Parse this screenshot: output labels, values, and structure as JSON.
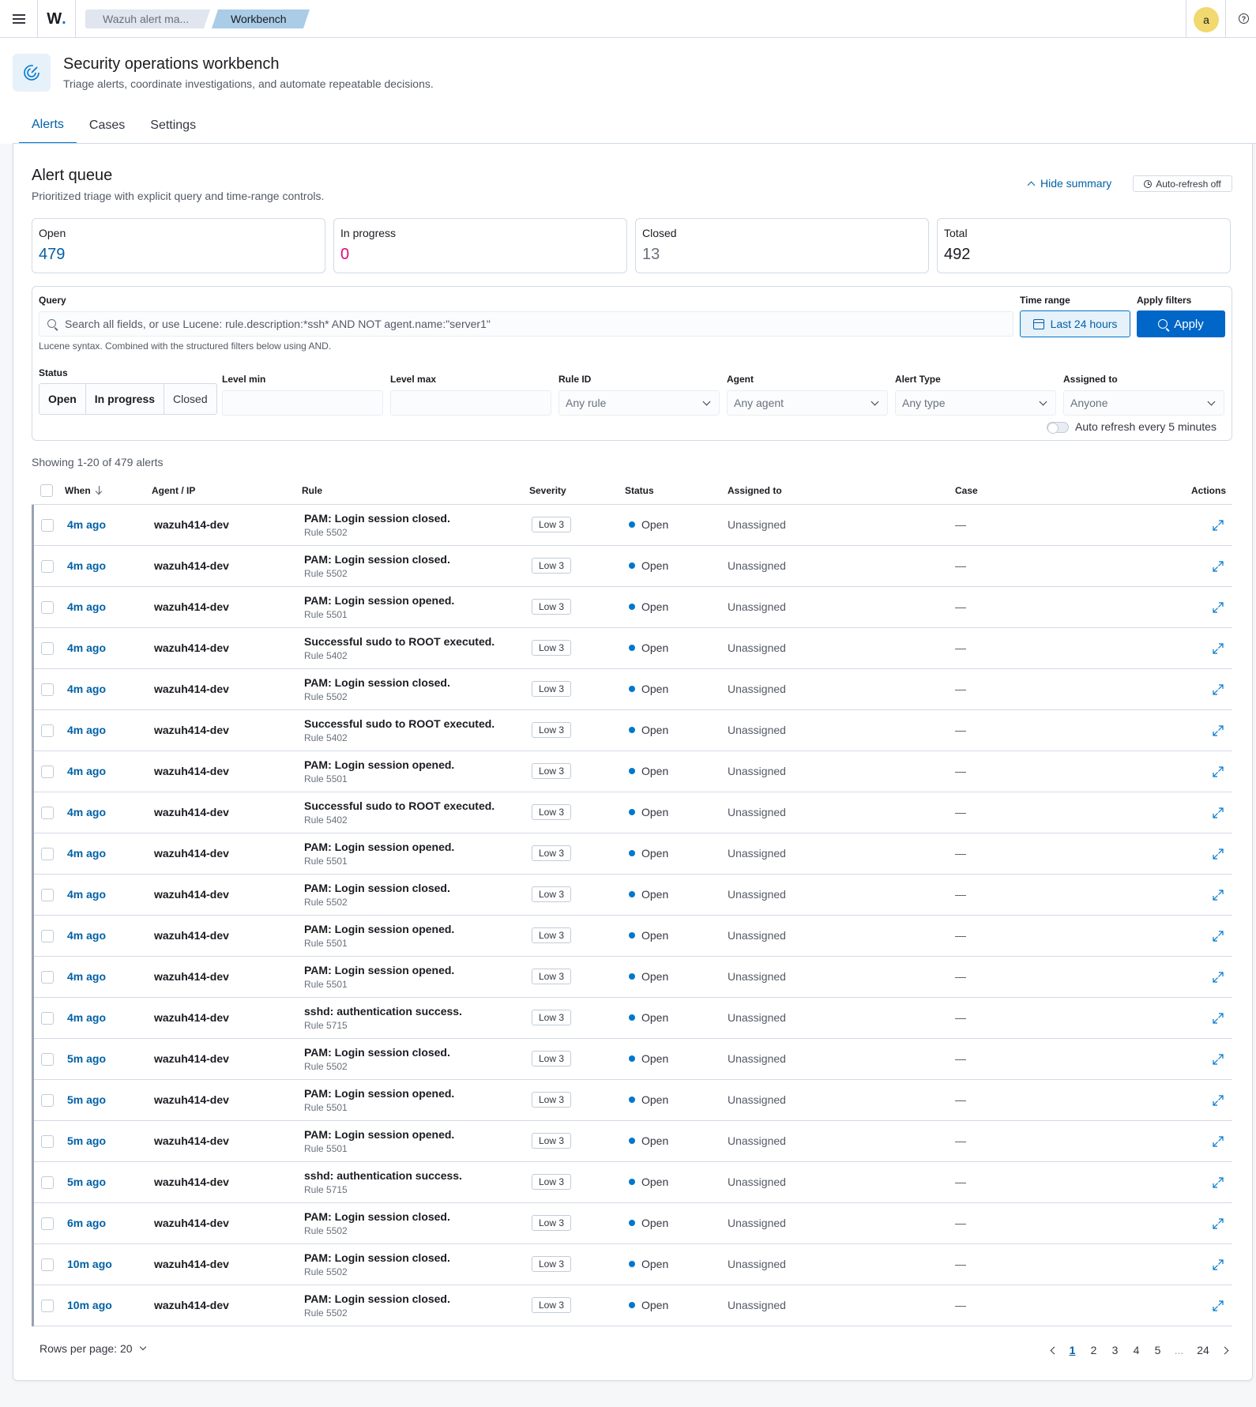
{
  "topbar": {
    "logo": "W",
    "logo_dot": ".",
    "breadcrumbs": [
      "Wazuh alert ma...",
      "Workbench"
    ],
    "avatar_initial": "a",
    "help_glyph": "?"
  },
  "header": {
    "title": "Security operations workbench",
    "subtitle": "Triage alerts, coordinate investigations, and automate repeatable decisions.",
    "tabs": [
      {
        "label": "Alerts",
        "active": true
      },
      {
        "label": "Cases",
        "active": false
      },
      {
        "label": "Settings",
        "active": false
      }
    ]
  },
  "queue": {
    "title": "Alert queue",
    "subtitle": "Prioritized triage with explicit query and time-range controls.",
    "hide_summary": "Hide summary",
    "auto_refresh_badge": "Auto-refresh off"
  },
  "stats": [
    {
      "label": "Open",
      "value": "479",
      "color": "#0061a6"
    },
    {
      "label": "In progress",
      "value": "0",
      "color": "#dd0a73"
    },
    {
      "label": "Closed",
      "value": "13",
      "color": "#69707d"
    },
    {
      "label": "Total",
      "value": "492",
      "color": "#1a1c21"
    }
  ],
  "filters": {
    "query_label": "Query",
    "query_placeholder": "Search all fields, or use Lucene: rule.description:*ssh* AND NOT agent.name:\"server1\"",
    "time_range_label": "Time range",
    "time_range_value": "Last 24 hours",
    "apply_label": "Apply filters",
    "apply_button": "Apply",
    "lucene_hint": "Lucene syntax. Combined with the structured filters below using AND.",
    "status_label": "Status",
    "status_options": [
      "Open",
      "In progress",
      "Closed"
    ],
    "level_min_label": "Level min",
    "level_max_label": "Level max",
    "rule_id_label": "Rule ID",
    "rule_id_value": "Any rule",
    "agent_label": "Agent",
    "agent_value": "Any agent",
    "alert_type_label": "Alert Type",
    "alert_type_value": "Any type",
    "assigned_label": "Assigned to",
    "assigned_value": "Anyone",
    "auto_refresh_toggle": "Auto refresh every 5 minutes"
  },
  "table": {
    "showing": "Showing 1-20 of 479 alerts",
    "columns": [
      "When",
      "Agent / IP",
      "Rule",
      "Severity",
      "Status",
      "Assigned to",
      "Case",
      "Actions"
    ],
    "rows": [
      {
        "when": "4m ago",
        "agent": "wazuh414-dev",
        "rule": "PAM: Login session closed.",
        "rule_id": "Rule 5502",
        "severity": "Low 3",
        "status": "Open",
        "assigned": "Unassigned",
        "case": "—"
      },
      {
        "when": "4m ago",
        "agent": "wazuh414-dev",
        "rule": "PAM: Login session closed.",
        "rule_id": "Rule 5502",
        "severity": "Low 3",
        "status": "Open",
        "assigned": "Unassigned",
        "case": "—"
      },
      {
        "when": "4m ago",
        "agent": "wazuh414-dev",
        "rule": "PAM: Login session opened.",
        "rule_id": "Rule 5501",
        "severity": "Low 3",
        "status": "Open",
        "assigned": "Unassigned",
        "case": "—"
      },
      {
        "when": "4m ago",
        "agent": "wazuh414-dev",
        "rule": "Successful sudo to ROOT executed.",
        "rule_id": "Rule 5402",
        "severity": "Low 3",
        "status": "Open",
        "assigned": "Unassigned",
        "case": "—"
      },
      {
        "when": "4m ago",
        "agent": "wazuh414-dev",
        "rule": "PAM: Login session closed.",
        "rule_id": "Rule 5502",
        "severity": "Low 3",
        "status": "Open",
        "assigned": "Unassigned",
        "case": "—"
      },
      {
        "when": "4m ago",
        "agent": "wazuh414-dev",
        "rule": "Successful sudo to ROOT executed.",
        "rule_id": "Rule 5402",
        "severity": "Low 3",
        "status": "Open",
        "assigned": "Unassigned",
        "case": "—"
      },
      {
        "when": "4m ago",
        "agent": "wazuh414-dev",
        "rule": "PAM: Login session opened.",
        "rule_id": "Rule 5501",
        "severity": "Low 3",
        "status": "Open",
        "assigned": "Unassigned",
        "case": "—"
      },
      {
        "when": "4m ago",
        "agent": "wazuh414-dev",
        "rule": "Successful sudo to ROOT executed.",
        "rule_id": "Rule 5402",
        "severity": "Low 3",
        "status": "Open",
        "assigned": "Unassigned",
        "case": "—"
      },
      {
        "when": "4m ago",
        "agent": "wazuh414-dev",
        "rule": "PAM: Login session opened.",
        "rule_id": "Rule 5501",
        "severity": "Low 3",
        "status": "Open",
        "assigned": "Unassigned",
        "case": "—"
      },
      {
        "when": "4m ago",
        "agent": "wazuh414-dev",
        "rule": "PAM: Login session closed.",
        "rule_id": "Rule 5502",
        "severity": "Low 3",
        "status": "Open",
        "assigned": "Unassigned",
        "case": "—"
      },
      {
        "when": "4m ago",
        "agent": "wazuh414-dev",
        "rule": "PAM: Login session opened.",
        "rule_id": "Rule 5501",
        "severity": "Low 3",
        "status": "Open",
        "assigned": "Unassigned",
        "case": "—"
      },
      {
        "when": "4m ago",
        "agent": "wazuh414-dev",
        "rule": "PAM: Login session opened.",
        "rule_id": "Rule 5501",
        "severity": "Low 3",
        "status": "Open",
        "assigned": "Unassigned",
        "case": "—"
      },
      {
        "when": "4m ago",
        "agent": "wazuh414-dev",
        "rule": "sshd: authentication success.",
        "rule_id": "Rule 5715",
        "severity": "Low 3",
        "status": "Open",
        "assigned": "Unassigned",
        "case": "—"
      },
      {
        "when": "5m ago",
        "agent": "wazuh414-dev",
        "rule": "PAM: Login session closed.",
        "rule_id": "Rule 5502",
        "severity": "Low 3",
        "status": "Open",
        "assigned": "Unassigned",
        "case": "—"
      },
      {
        "when": "5m ago",
        "agent": "wazuh414-dev",
        "rule": "PAM: Login session opened.",
        "rule_id": "Rule 5501",
        "severity": "Low 3",
        "status": "Open",
        "assigned": "Unassigned",
        "case": "—"
      },
      {
        "when": "5m ago",
        "agent": "wazuh414-dev",
        "rule": "PAM: Login session opened.",
        "rule_id": "Rule 5501",
        "severity": "Low 3",
        "status": "Open",
        "assigned": "Unassigned",
        "case": "—"
      },
      {
        "when": "5m ago",
        "agent": "wazuh414-dev",
        "rule": "sshd: authentication success.",
        "rule_id": "Rule 5715",
        "severity": "Low 3",
        "status": "Open",
        "assigned": "Unassigned",
        "case": "—"
      },
      {
        "when": "6m ago",
        "agent": "wazuh414-dev",
        "rule": "PAM: Login session closed.",
        "rule_id": "Rule 5502",
        "severity": "Low 3",
        "status": "Open",
        "assigned": "Unassigned",
        "case": "—"
      },
      {
        "when": "10m ago",
        "agent": "wazuh414-dev",
        "rule": "PAM: Login session closed.",
        "rule_id": "Rule 5502",
        "severity": "Low 3",
        "status": "Open",
        "assigned": "Unassigned",
        "case": "—"
      },
      {
        "when": "10m ago",
        "agent": "wazuh414-dev",
        "rule": "PAM: Login session closed.",
        "rule_id": "Rule 5502",
        "severity": "Low 3",
        "status": "Open",
        "assigned": "Unassigned",
        "case": "—"
      }
    ]
  },
  "pagination": {
    "rows_per_page": "Rows per page: 20",
    "pages": [
      "1",
      "2",
      "3",
      "4",
      "5",
      "...",
      "24"
    ],
    "current": "1"
  },
  "colors": {
    "accent": "#0077cc",
    "link": "#0061a6",
    "primary_button": "#0066c7",
    "status_open_dot": "#0077cc"
  }
}
